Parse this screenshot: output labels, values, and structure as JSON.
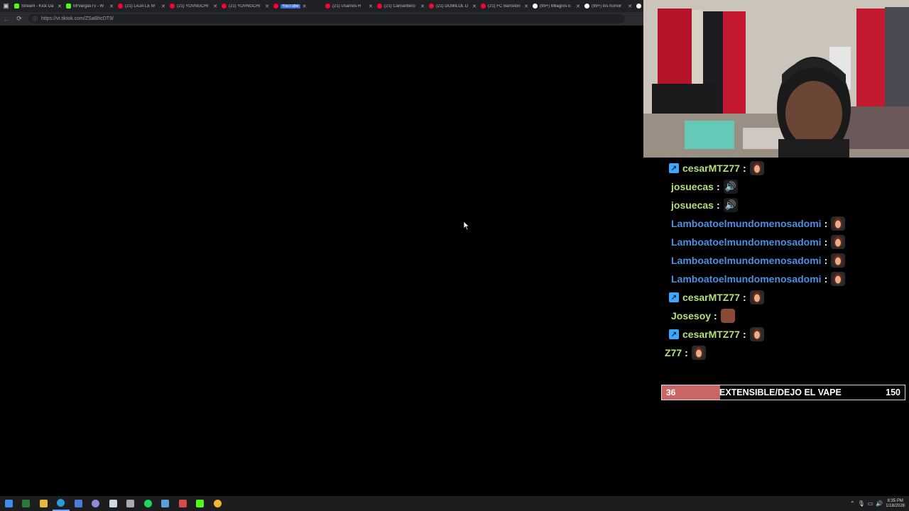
{
  "browser": {
    "tabs": [
      {
        "title": "Stream - Kick Da",
        "favicon": "kick-icon",
        "active": false
      },
      {
        "title": "MrVargasTv - W",
        "favicon": "kick-icon",
        "active": false
      },
      {
        "title": "(21) LAJA LE M",
        "favicon": "youtube-icon",
        "active": false
      },
      {
        "title": "(21) YOVNGCHI",
        "favicon": "youtube-icon",
        "active": false
      },
      {
        "title": "(21) YOVNGCHI",
        "favicon": "youtube-icon",
        "active": false
      },
      {
        "title": "YouTube",
        "favicon": "youtube-icon",
        "active": true
      },
      {
        "title": "(21) Usamos R",
        "favicon": "youtube-icon",
        "active": false
      },
      {
        "title": "(21) Canserbero",
        "favicon": "youtube-icon",
        "active": false
      },
      {
        "title": "(21) DOMILOL D",
        "favicon": "youtube-icon",
        "active": false
      },
      {
        "title": "(21) FC Barcelon",
        "favicon": "youtube-icon",
        "active": false
      },
      {
        "title": "(99+) Milagros E",
        "favicon": "tiktok-icon",
        "active": false
      },
      {
        "title": "(99+) los humor",
        "favicon": "tiktok-icon",
        "active": false
      },
      {
        "title": "(99+)",
        "favicon": "tiktok-icon",
        "active": false
      }
    ],
    "url": "https://vt.tiktok.com/ZSaBhcDT9/"
  },
  "chat": {
    "messages": [
      {
        "user": "cesarMTZ77",
        "badge": true,
        "color": "green",
        "emote": "face"
      },
      {
        "user": "josuecas",
        "badge": false,
        "color": "green",
        "emote": "speaker"
      },
      {
        "user": "josuecas",
        "badge": false,
        "color": "green",
        "emote": "speaker"
      },
      {
        "user": "Lamboatoelmundomenosadomi",
        "badge": false,
        "color": "blue",
        "emote": "face"
      },
      {
        "user": "Lamboatoelmundomenosadomi",
        "badge": false,
        "color": "blue",
        "emote": "face"
      },
      {
        "user": "Lamboatoelmundomenosadomi",
        "badge": false,
        "color": "blue",
        "emote": "face"
      },
      {
        "user": "Lamboatoelmundomenosadomi",
        "badge": false,
        "color": "blue",
        "emote": "face"
      },
      {
        "user": "cesarMTZ77",
        "badge": true,
        "color": "green",
        "emote": "face"
      },
      {
        "user": "Josesoy",
        "badge": false,
        "color": "green",
        "emote": "brick"
      },
      {
        "user": "cesarMTZ77",
        "badge": true,
        "color": "green",
        "emote": "face"
      }
    ],
    "partial": {
      "user": "Z77",
      "emote": "face"
    },
    "colors": {
      "green": "#b2e07a",
      "blue": "#4d8fe0",
      "badge": "#3ea6ff"
    }
  },
  "goal": {
    "current": "36",
    "label": "EXTENSIBLE/DEJO EL VAPE",
    "target": "150",
    "progress": 0.24,
    "fill_color": "#c96565"
  },
  "taskbar": {
    "apps": [
      "windows-start-icon",
      "terminal-icon",
      "file-explorer-icon",
      "edge-browser-icon",
      "store-icon",
      "obs-icon",
      "steam-icon",
      "paint-icon",
      "spotify-icon",
      "notepad-icon",
      "chrome-alt-icon",
      "kick-icon",
      "chrome-icon"
    ],
    "clock_time": "8:35 PM",
    "clock_date": "1/18/2028"
  }
}
